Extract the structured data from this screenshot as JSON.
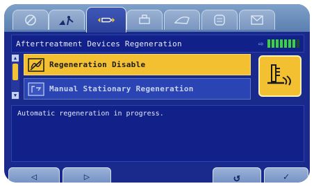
{
  "tabs": [
    {
      "icon": "gauge-icon"
    },
    {
      "icon": "service-icon"
    },
    {
      "icon": "exhaust-icon",
      "active": true
    },
    {
      "icon": "engine-icon"
    },
    {
      "icon": "machine-icon"
    },
    {
      "icon": "display-icon"
    },
    {
      "icon": "message-icon"
    }
  ],
  "header": {
    "title": "Aftertreatment Devices Regeneration",
    "meter_icon": "exhaust-flow-icon",
    "meter_level": 0.85
  },
  "menu": {
    "items": [
      {
        "label": "Regeneration Disable",
        "icon": "regen-disable-icon",
        "selected": true
      },
      {
        "label": "Manual Stationary Regeneration",
        "icon": "manual-regen-icon",
        "selected": false
      }
    ],
    "feature_icon": "exhaust-regeneration-icon"
  },
  "message": {
    "text": "Automatic regeneration in progress."
  },
  "buttons": {
    "left": "left-arrow-icon",
    "right": "right-arrow-icon",
    "back": "back-icon",
    "ok": "check-icon"
  },
  "colors": {
    "screen_bg": "#1a2a8c",
    "highlight": "#f2c030",
    "meter": "#39d43a"
  }
}
